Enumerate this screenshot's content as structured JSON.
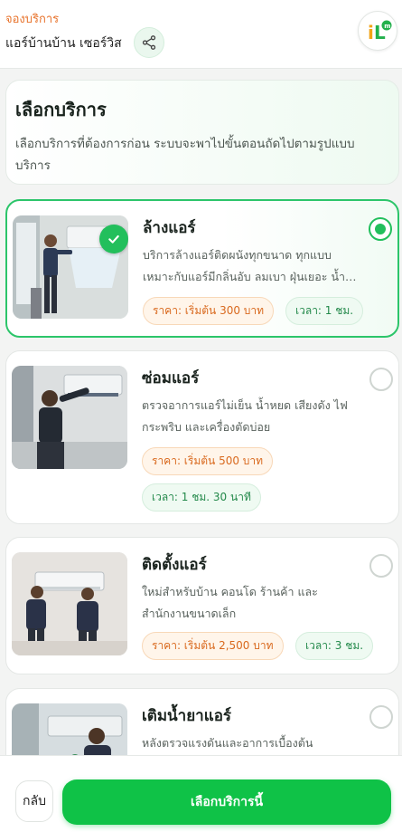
{
  "header": {
    "breadcrumb": "จองบริการ",
    "shop_name": "แอร์บ้านบ้าน เซอร์วิส",
    "share_icon": "share-icon",
    "logo_text": "iL"
  },
  "intro": {
    "title": "เลือกบริการ",
    "description": "เลือกบริการที่ต้องการก่อน ระบบจะพาไปขั้นตอนถัดไปตามรูปแบบบริการ"
  },
  "services": [
    {
      "title": "ล้างแอร์",
      "description": "บริการล้างแอร์ติดผนังทุกขนาด ทุกแบบ เหมาะกับแอร์มีกลิ่นอับ ลมเบา ฝุ่นเยอะ น้ำหยด",
      "price": "ราคา: เริ่มต้น 300 บาท",
      "time": "เวลา: 1 ชม.",
      "selected": true
    },
    {
      "title": "ซ่อมแอร์",
      "description": "ตรวจอาการแอร์ไม่เย็น น้ำหยด เสียงดัง ไฟกระพริบ และเครื่องตัดบ่อย",
      "price": "ราคา: เริ่มต้น 500 บาท",
      "time": "เวลา: 1 ชม. 30 นาที",
      "selected": false
    },
    {
      "title": "ติดตั้งแอร์",
      "description": "ใหม่สำหรับบ้าน คอนโด ร้านค้า และสำนักงานขนาดเล็ก",
      "price": "ราคา: เริ่มต้น 2,500 บาท",
      "time": "เวลา: 3 ชม.",
      "selected": false
    },
    {
      "title": "เติมน้ำยาแอร์",
      "description": "หลังตรวจแรงดันและอาการเบื้องต้น",
      "selected": false
    }
  ],
  "footer": {
    "back_label": "กลับ",
    "primary_label": "เลือกบริการนี้"
  },
  "colors": {
    "accent": "#0fc247",
    "breadcrumb": "#e8732c",
    "price_text": "#d9691e",
    "time_text": "#23894a"
  }
}
